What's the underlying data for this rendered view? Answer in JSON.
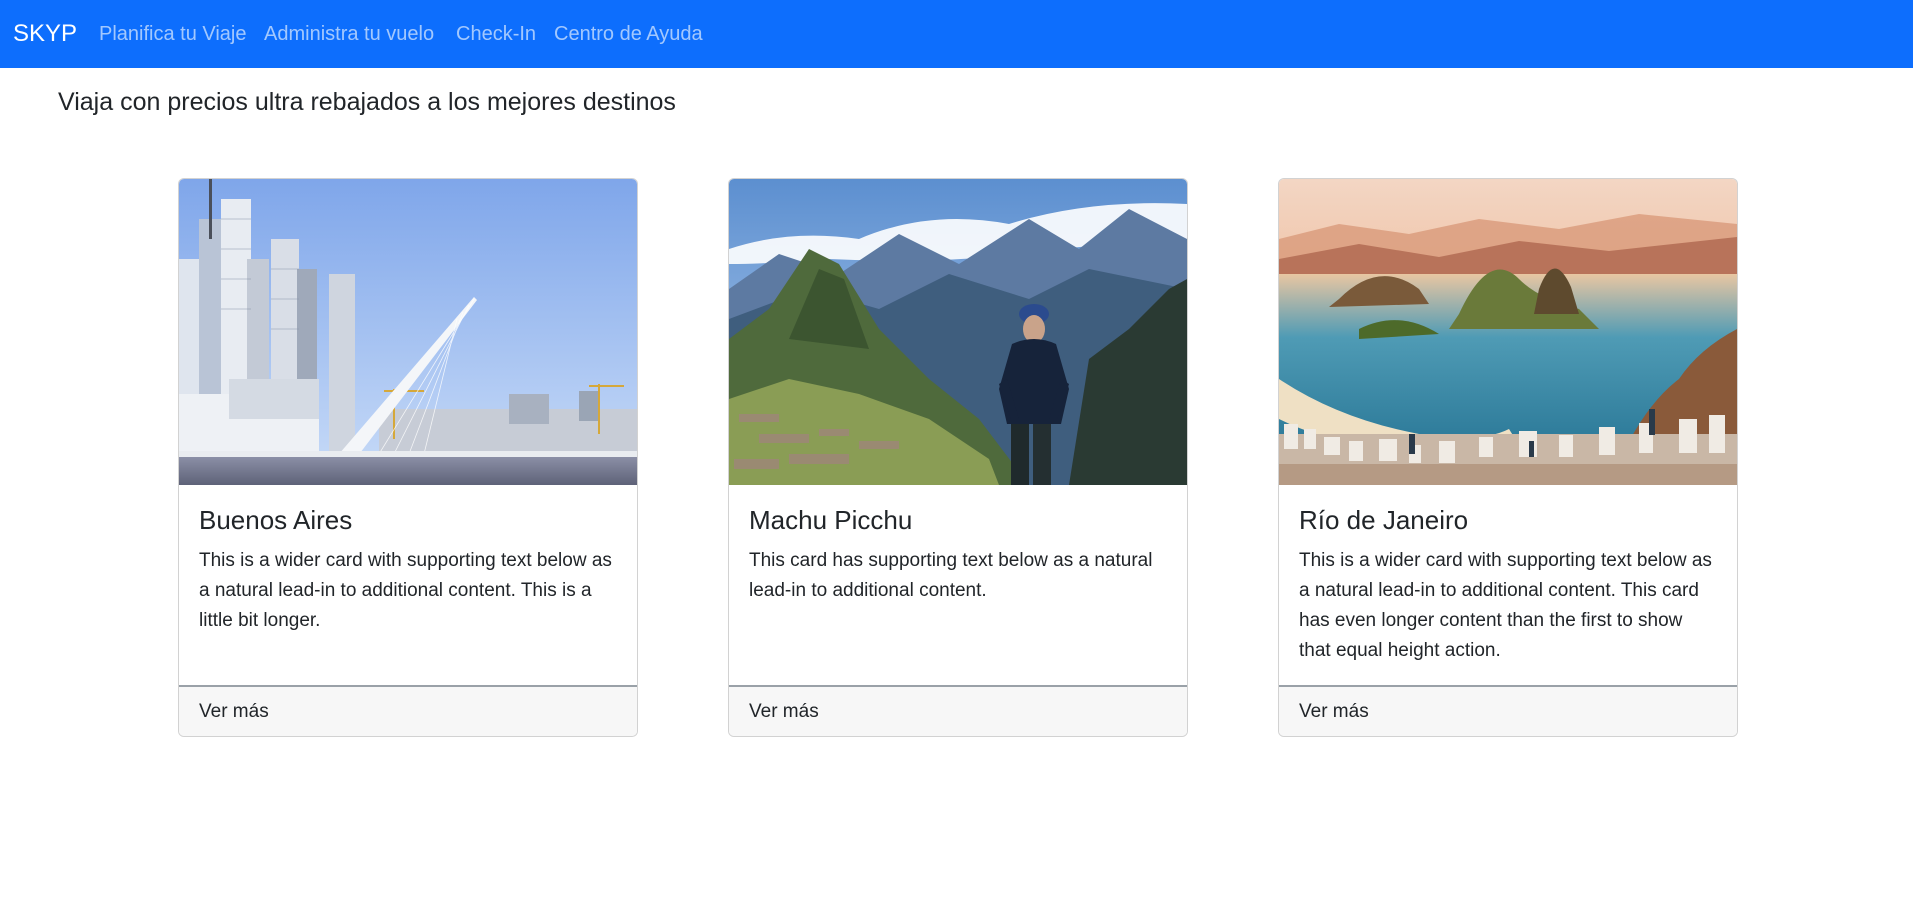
{
  "navbar": {
    "brand": "SKYP",
    "links": [
      {
        "label": "Planifica tu Viaje"
      },
      {
        "label": "Administra tu vuelo"
      },
      {
        "label": "Check-In"
      },
      {
        "label": "Centro de Ayuda"
      }
    ],
    "background": "#0d6efd"
  },
  "main": {
    "title": "Viaja con precios ultra rebajados a los mejores destinos",
    "cards": [
      {
        "image_alt": "Buenos Aires skyline with Puente de la Mujer",
        "title": "Buenos Aires",
        "text": "This is a wider card with supporting text below as a natural lead-in to additional content. This is a little bit longer.",
        "footer_link": "Ver más"
      },
      {
        "image_alt": "Hiker overlooking Machu Picchu",
        "title": "Machu Picchu",
        "text": "This card has supporting text below as a natural lead-in to additional content.",
        "footer_link": "Ver más"
      },
      {
        "image_alt": "Rio de Janeiro bay with Sugarloaf Mountain at sunset",
        "title": "Río de Janeiro",
        "text": "This is a wider card with supporting text below as a natural lead-in to additional content. This card has even longer content than the first to show that equal height action.",
        "footer_link": "Ver más"
      }
    ]
  }
}
